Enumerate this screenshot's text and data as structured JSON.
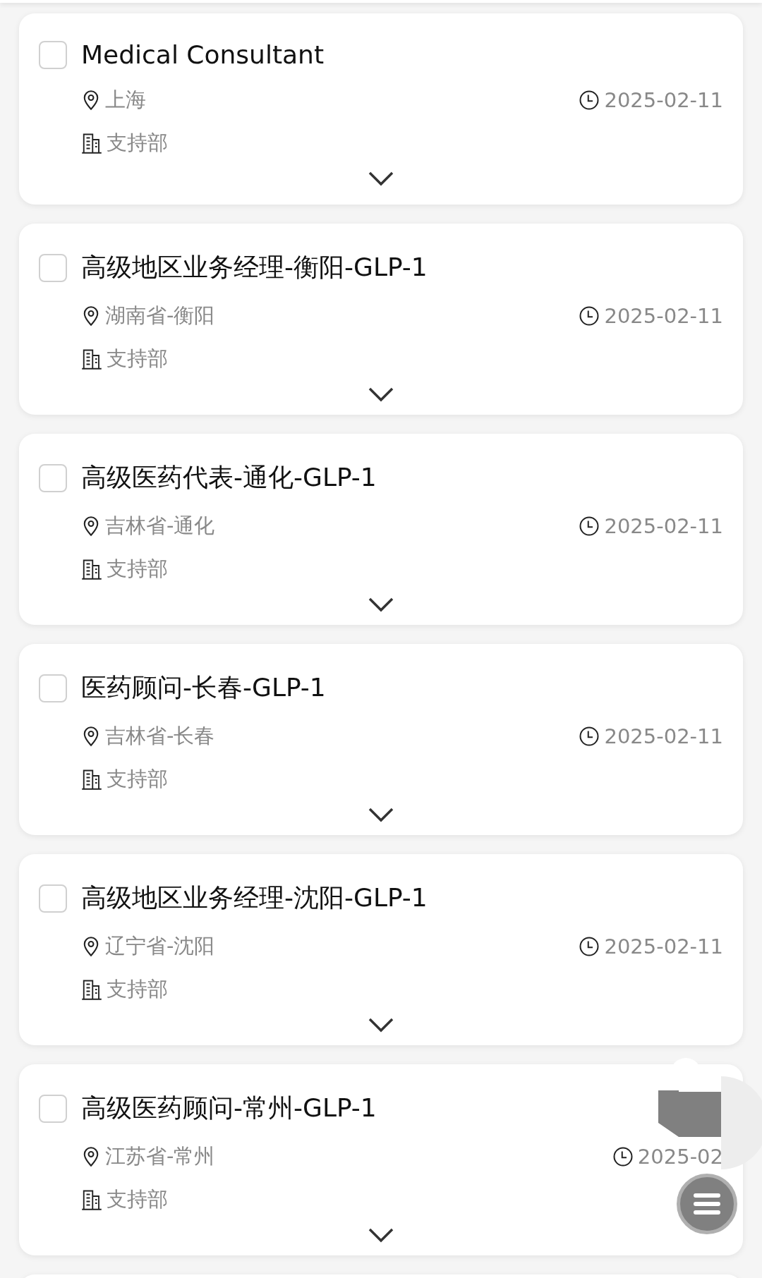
{
  "jobs": [
    {
      "title": "Medical Consultant",
      "location": "上海",
      "date": "2025-02-11",
      "department": "支持部",
      "checked": false,
      "expanded": false
    },
    {
      "title": "高级地区业务经理-衡阳-GLP-1",
      "location": "湖南省-衡阳",
      "date": "2025-02-11",
      "department": "支持部",
      "checked": false,
      "expanded": false
    },
    {
      "title": "高级医药代表-通化-GLP-1",
      "location": "吉林省-通化",
      "date": "2025-02-11",
      "department": "支持部",
      "checked": false,
      "expanded": false
    },
    {
      "title": "医药顾问-长春-GLP-1",
      "location": "吉林省-长春",
      "date": "2025-02-11",
      "department": "支持部",
      "checked": false,
      "expanded": false
    },
    {
      "title": "高级地区业务经理-沈阳-GLP-1",
      "location": "辽宁省-沈阳",
      "date": "2025-02-11",
      "department": "支持部",
      "checked": false,
      "expanded": false
    },
    {
      "title": "高级医药顾问-常州-GLP-1",
      "location": "江苏省-常州",
      "date": "2025-02",
      "department": "支持部",
      "checked": false,
      "expanded": false
    }
  ]
}
